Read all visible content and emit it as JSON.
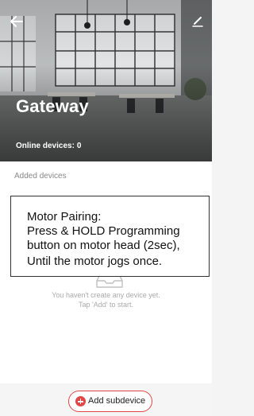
{
  "header": {
    "back_icon": "arrow-left-icon",
    "edit_icon": "pencil-icon",
    "title": "Gateway",
    "online_label": "Online devices:",
    "online_count": "0"
  },
  "main": {
    "section_label": "Added devices",
    "empty_icon": "empty-tray-icon",
    "empty_line1": "You haven't create any device yet.",
    "empty_line2": "Tap 'Add' to start."
  },
  "overlay": {
    "line1": "Motor Pairing:",
    "line2": "Press & HOLD Programming",
    "line3": "button on motor head (2sec),",
    "line4": "Until the motor jogs once."
  },
  "footer": {
    "add_icon": "plus-circle-icon",
    "add_label": "Add subdevice",
    "accent_color": "#e04848"
  }
}
